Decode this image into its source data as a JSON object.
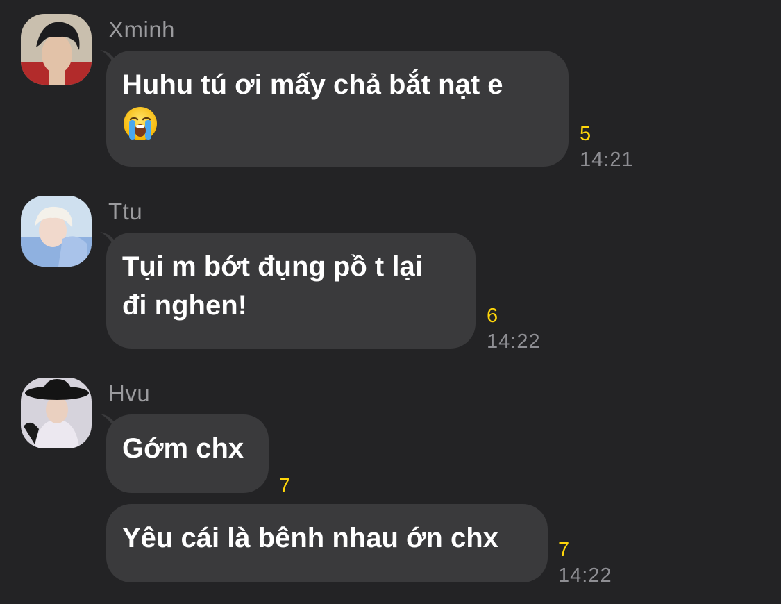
{
  "messages": [
    {
      "sender": "Xminh",
      "avatar_icon": "avatar-xminh",
      "lines": [
        "Huhu tú ơi mấy chả bắt nạt e"
      ],
      "emoji": "loudly-crying-face-emoji",
      "count": "5",
      "time": "14:21"
    },
    {
      "sender": "Ttu",
      "avatar_icon": "avatar-ttu",
      "lines": [
        "Tụi m bớt đụng pồ t lại",
        "đi nghen!"
      ],
      "count": "6",
      "time": "14:22"
    },
    {
      "sender": "Hvu",
      "avatar_icon": "avatar-hvu",
      "lines": [
        "Gớm chx"
      ],
      "count": "7"
    },
    {
      "lines": [
        "Yêu cái là bênh nhau ớn chx"
      ],
      "count": "7",
      "time": "14:22"
    }
  ],
  "colors": {
    "background": "#232325",
    "bubble": "#3a3a3c",
    "count": "#ffd60a",
    "time": "#8e8e93",
    "sender": "#9b9b9e"
  }
}
